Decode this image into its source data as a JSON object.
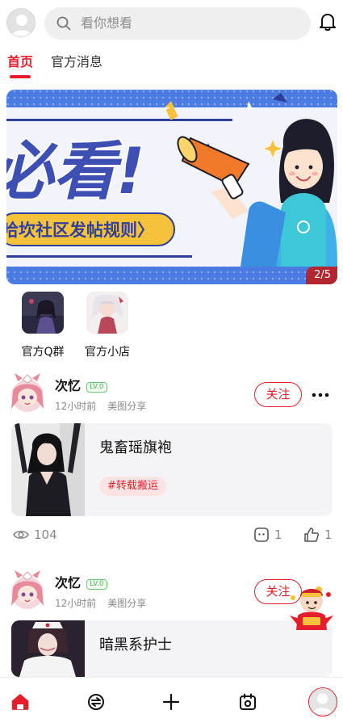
{
  "search": {
    "placeholder": "看你想看"
  },
  "tabs": [
    {
      "label": "首页",
      "active": true
    },
    {
      "label": "官方消息",
      "active": false
    }
  ],
  "banner": {
    "headline": "必看!",
    "subline": "哈坎社区发帖规则〉",
    "page_indicator": "2/5"
  },
  "quick_links": [
    {
      "label": "官方Q群"
    },
    {
      "label": "官方小店"
    }
  ],
  "posts": [
    {
      "author": "次忆",
      "level": "LV.0",
      "time": "12小时前",
      "category": "美图分享",
      "follow_label": "关注",
      "title": "鬼畜瑶旗袍",
      "tag": "#转载搬运",
      "views": "104",
      "comments": "1",
      "likes": "1"
    },
    {
      "author": "次忆",
      "level": "LV.0",
      "time": "12小时前",
      "category": "美图分享",
      "follow_label": "关注",
      "title": "暗黑系护士"
    }
  ],
  "colors": {
    "accent": "#e41f2b",
    "banner_blue": "#2f3f9c",
    "banner_yellow": "#f7c23b"
  },
  "icons": {
    "top_left": "user-avatar-icon",
    "search": "search-icon",
    "notification": "bell-icon",
    "more": "more-dots-icon",
    "views": "eye-icon",
    "comments": "comment-icon",
    "likes": "thumbs-up-icon",
    "nav": [
      "home-icon",
      "discover-icon",
      "add-icon",
      "calendar-icon",
      "profile-avatar-icon"
    ]
  }
}
